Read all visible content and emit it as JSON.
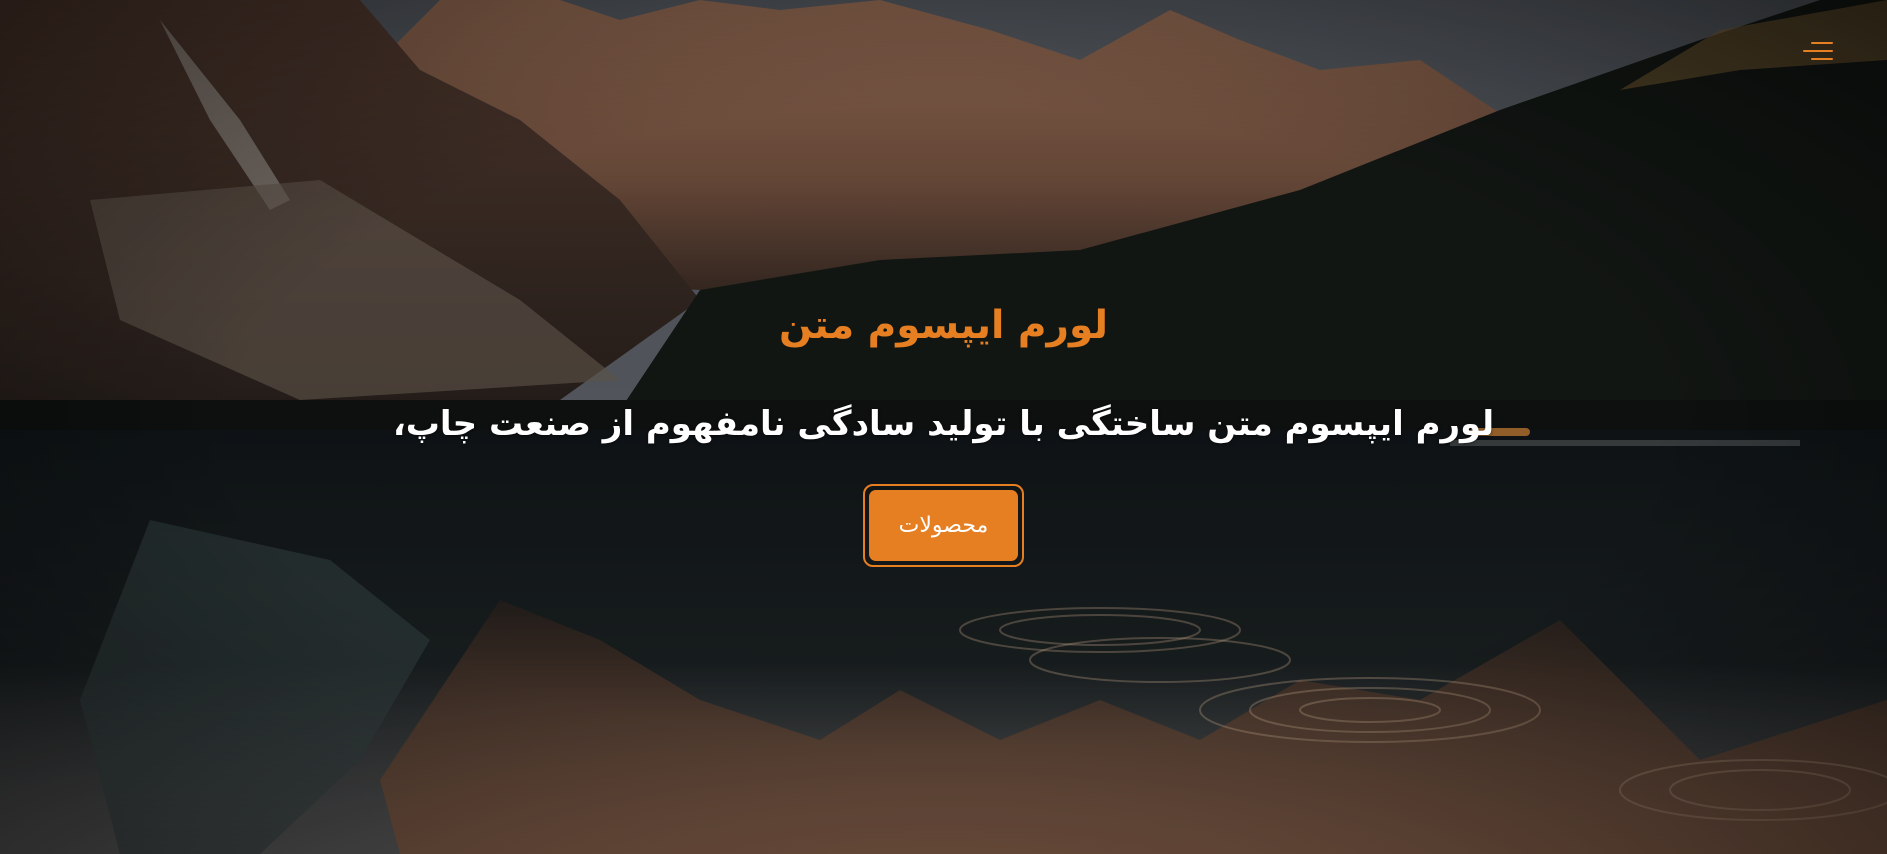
{
  "header": {
    "menu_icon": "hamburger-menu-icon"
  },
  "hero": {
    "title": "لورم ایپسوم متن",
    "subtitle": "لورم ایپسوم متن ساختگی با تولید سادگی نامفهوم از صنعت چاپ،",
    "cta_label": "محصولات",
    "background": "mountain-lake-landscape"
  },
  "colors": {
    "accent": "#e67e22",
    "text": "#ffffff"
  }
}
